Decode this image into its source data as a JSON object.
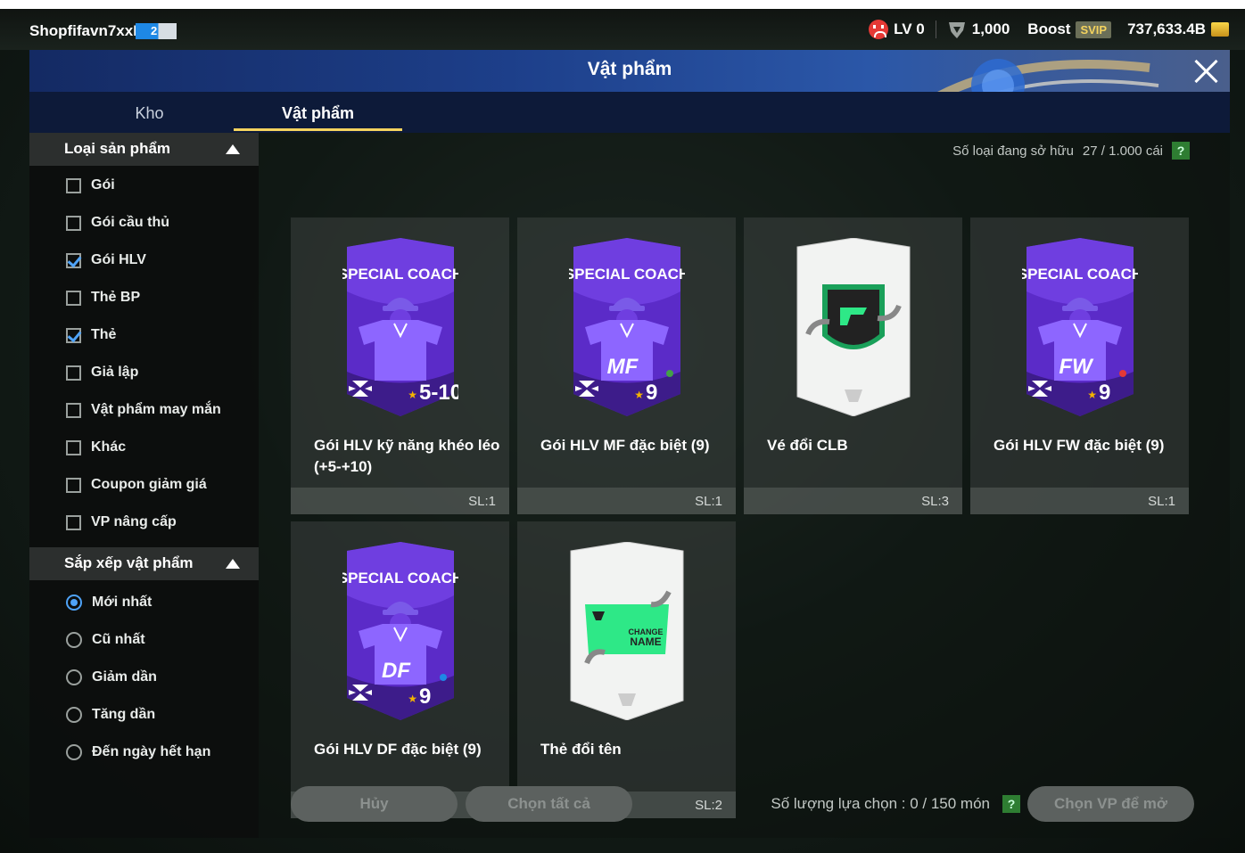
{
  "topbar": {
    "username": "Shopfifavn7xxB",
    "user_level": "2",
    "lv_label": "LV 0",
    "points": "1,000",
    "boost_label": "Boost",
    "svip_label": "SVIP",
    "balance": "737,633.4B"
  },
  "window": {
    "title": "Vật phẩm"
  },
  "tabs": [
    {
      "label": "Kho",
      "active": false
    },
    {
      "label": "Vật phẩm",
      "active": true
    }
  ],
  "sidebar": {
    "category_header": "Loại sản phẩm",
    "categories": [
      {
        "label": "Gói",
        "checked": false
      },
      {
        "label": "Gói cầu thủ",
        "checked": false
      },
      {
        "label": "Gói HLV",
        "checked": true
      },
      {
        "label": "Thẻ BP",
        "checked": false
      },
      {
        "label": "Thẻ",
        "checked": true
      },
      {
        "label": "Giả lập",
        "checked": false
      },
      {
        "label": "Vật phẩm may mắn",
        "checked": false
      },
      {
        "label": "Khác",
        "checked": false
      },
      {
        "label": "Coupon giảm giá",
        "checked": false
      },
      {
        "label": "VP nâng cấp",
        "checked": false
      }
    ],
    "sort_header": "Sắp xếp vật phẩm",
    "sort_options": [
      {
        "label": "Mới nhất",
        "selected": true
      },
      {
        "label": "Cũ nhất",
        "selected": false
      },
      {
        "label": "Giảm dần",
        "selected": false
      },
      {
        "label": "Tăng dần",
        "selected": false
      },
      {
        "label": "Đến ngày hết hạn",
        "selected": false
      }
    ]
  },
  "content": {
    "owned_label": "Số loại đang sở hữu",
    "owned_value": "27 / 1.000 cái",
    "help": "?",
    "items": [
      {
        "name": "Gói HLV kỹ năng khéo léo (+5-+10)",
        "qty": "SL:1",
        "art": "coach",
        "header": "SPECIAL COACH",
        "position": "",
        "grade": "5-10",
        "dot": ""
      },
      {
        "name": "Gói HLV MF đặc biệt (9)",
        "qty": "SL:1",
        "art": "coach",
        "header": "SPECIAL COACH",
        "position": "MF",
        "grade": "9",
        "dot": "#43a047"
      },
      {
        "name": "Vé đổi CLB",
        "qty": "SL:3",
        "art": "club",
        "header": "",
        "position": "",
        "grade": "",
        "dot": ""
      },
      {
        "name": "Gói HLV FW đặc biệt (9)",
        "qty": "SL:1",
        "art": "coach",
        "header": "SPECIAL COACH",
        "position": "FW",
        "grade": "9",
        "dot": "#e53935"
      },
      {
        "name": "Gói HLV DF đặc biệt (9)",
        "qty": "SL:1",
        "art": "coach",
        "header": "SPECIAL COACH",
        "position": "DF",
        "grade": "9",
        "dot": "#1e88e5"
      },
      {
        "name": "Thẻ đổi tên",
        "qty": "SL:2",
        "art": "rename",
        "header": "",
        "position": "",
        "grade": "",
        "dot": "",
        "art_text_1": "CHANGE",
        "art_text_2": "NAME"
      }
    ]
  },
  "bottom": {
    "cancel_label": "Hủy",
    "select_all_label": "Chọn tất cả",
    "selected_label": "Số lượng lựa chọn : 0 / 150 món",
    "help": "?",
    "open_label": "Chọn VP để mở"
  },
  "colors": {
    "accent_yellow": "#f4d35e",
    "check_blue": "#4fa3f7",
    "coach_purple": "#5b2bc8",
    "help_green": "#2e7d32"
  }
}
